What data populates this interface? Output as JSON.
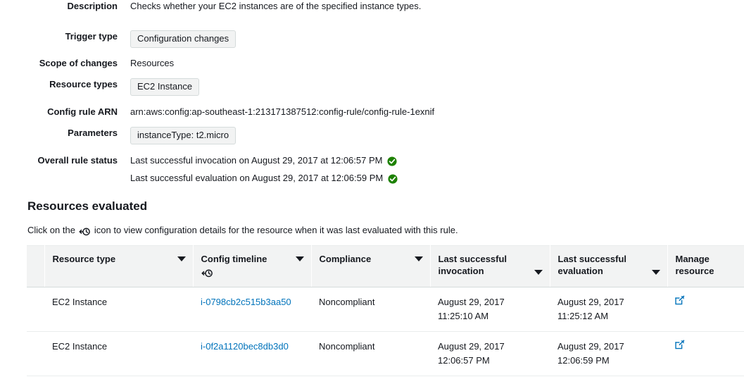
{
  "details": [
    {
      "label": "Description",
      "type": "text",
      "value": "Checks whether your EC2 instances are of the specified instance types."
    },
    {
      "label": "Trigger type",
      "type": "pill",
      "value": "Configuration changes"
    },
    {
      "label": "Scope of changes",
      "type": "text",
      "value": "Resources"
    },
    {
      "label": "Resource types",
      "type": "pill",
      "value": "EC2 Instance"
    },
    {
      "label": "Config rule ARN",
      "type": "text",
      "value": "arn:aws:config:ap-southeast-1:213171387512:config-rule/config-rule-1exnif"
    },
    {
      "label": "Parameters",
      "type": "pill",
      "value": "instanceType: t2.micro"
    },
    {
      "label": "Overall rule status",
      "type": "status",
      "value": ""
    }
  ],
  "labels": {
    "description": "Description",
    "trigger_type": "Trigger type",
    "scope_of_changes": "Scope of changes",
    "resource_types": "Resource types",
    "config_rule_arn": "Config rule ARN",
    "parameters": "Parameters",
    "overall_rule_status": "Overall rule status"
  },
  "values": {
    "description": "Checks whether your EC2 instances are of the specified instance types.",
    "trigger_type": "Configuration changes",
    "scope_of_changes": "Resources",
    "resource_types": "EC2 Instance",
    "config_rule_arn": "arn:aws:config:ap-southeast-1:213171387512:config-rule/config-rule-1exnif",
    "parameters": "instanceType: t2.micro",
    "status_invocation": "Last successful invocation on August 29, 2017 at 12:06:57 PM",
    "status_evaluation": "Last successful evaluation on August 29, 2017 at 12:06:59 PM"
  },
  "section": {
    "title": "Resources evaluated",
    "desc_before_icon": "Click on the",
    "desc_after_icon": "icon to view configuration details for the resource when it was last evaluated with this rule."
  },
  "table": {
    "columns": [
      {
        "label": "Resource type",
        "sortable": true
      },
      {
        "label": "Config timeline",
        "sortable": true,
        "icon": "config-timeline-icon"
      },
      {
        "label": "Compliance",
        "sortable": true
      },
      {
        "label": "Last successful invocation",
        "sortable": true
      },
      {
        "label": "Last successful evaluation",
        "sortable": true
      },
      {
        "label": "Manage resource",
        "sortable": false
      }
    ],
    "rows": [
      {
        "resource_type": "EC2 Instance",
        "config_timeline": "i-0798cb2c515b3aa50",
        "compliance": "Noncompliant",
        "invocation_date": "August 29, 2017",
        "invocation_time": "11:25:10 AM",
        "evaluation_date": "August 29, 2017",
        "evaluation_time": "11:25:12 AM",
        "manage_icon": "external-link-icon"
      },
      {
        "resource_type": "EC2 Instance",
        "config_timeline": "i-0f2a1120bec8db3d0",
        "compliance": "Noncompliant",
        "invocation_date": "August 29, 2017",
        "invocation_time": "12:06:57 PM",
        "evaluation_date": "August 29, 2017",
        "evaluation_time": "12:06:59 PM",
        "manage_icon": "external-link-icon"
      }
    ]
  },
  "colors": {
    "link": "#0073bb",
    "noncompliant": "#d13212",
    "success_check": "#1d8102",
    "header_bg": "#f2f3f3",
    "text": "#16191f"
  }
}
